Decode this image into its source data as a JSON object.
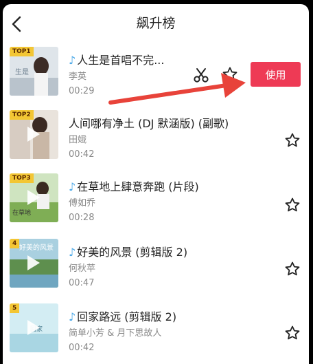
{
  "header": {
    "title": "飙升榜"
  },
  "songs": [
    {
      "rank": "TOP1",
      "has_icon": true,
      "title": "人生是首唱不完...",
      "artist": "李英",
      "duration": "00:29"
    },
    {
      "rank": "TOP2",
      "has_icon": false,
      "title": "人间哪有净土 (DJ 默涵版) (副歌)",
      "artist": "田娥",
      "duration": "00:42"
    },
    {
      "rank": "TOP3",
      "has_icon": true,
      "title": "在草地上肆意奔跑 (片段)",
      "artist": "傅如乔",
      "duration": "00:28"
    },
    {
      "rank": "4",
      "has_icon": true,
      "title": "好美的风景 (剪辑版 2)",
      "artist": "何秋苹",
      "duration": "00:47"
    },
    {
      "rank": "5",
      "has_icon": true,
      "title": "回家路远 (剪辑版 2)",
      "artist": "简单小芳 & 月下思故人",
      "duration": "00:42"
    }
  ],
  "actions": {
    "use_label": "使用"
  },
  "colors": {
    "accent": "#ee3a55",
    "rank_badge": "#f3c634",
    "music_note": "#4aa8e8",
    "arrow": "#e8433a"
  },
  "icons": [
    "back-arrow-icon",
    "music-note-icon",
    "scissors-icon",
    "star-icon",
    "play-icon"
  ]
}
